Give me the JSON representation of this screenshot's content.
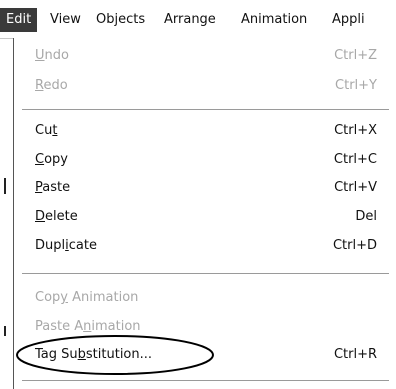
{
  "menubar": {
    "items": [
      "Edit",
      "View",
      "Objects",
      "Arrange",
      "Animation",
      "Appli"
    ]
  },
  "menu": {
    "groups": [
      [
        {
          "label": "Undo",
          "mnemonic": "U",
          "shortcut": "Ctrl+Z",
          "enabled": false
        },
        {
          "label": "Redo",
          "mnemonic": "R",
          "shortcut": "Ctrl+Y",
          "enabled": false
        }
      ],
      [
        {
          "label": "Cut",
          "mnemonic": "t",
          "shortcut": "Ctrl+X",
          "enabled": true
        },
        {
          "label": "Copy",
          "mnemonic": "C",
          "shortcut": "Ctrl+C",
          "enabled": true
        },
        {
          "label": "Paste",
          "mnemonic": "P",
          "shortcut": "Ctrl+V",
          "enabled": true
        },
        {
          "label": "Delete",
          "mnemonic": "D",
          "shortcut": "Del",
          "enabled": true
        },
        {
          "label": "Duplicate",
          "mnemonic": "i",
          "shortcut": "Ctrl+D",
          "enabled": true
        }
      ],
      [
        {
          "label": "Copy Animation",
          "mnemonic": "y",
          "shortcut": "",
          "enabled": false
        },
        {
          "label": "Paste Animation",
          "mnemonic": "n",
          "shortcut": "",
          "enabled": false
        },
        {
          "label": "Tag Substitution...",
          "mnemonic": "b",
          "shortcut": "Ctrl+R",
          "enabled": true,
          "circled": true
        }
      ]
    ]
  },
  "colors": {
    "active_menu_bg": "#3a3a3a",
    "disabled_text": "#a8a8a8"
  }
}
